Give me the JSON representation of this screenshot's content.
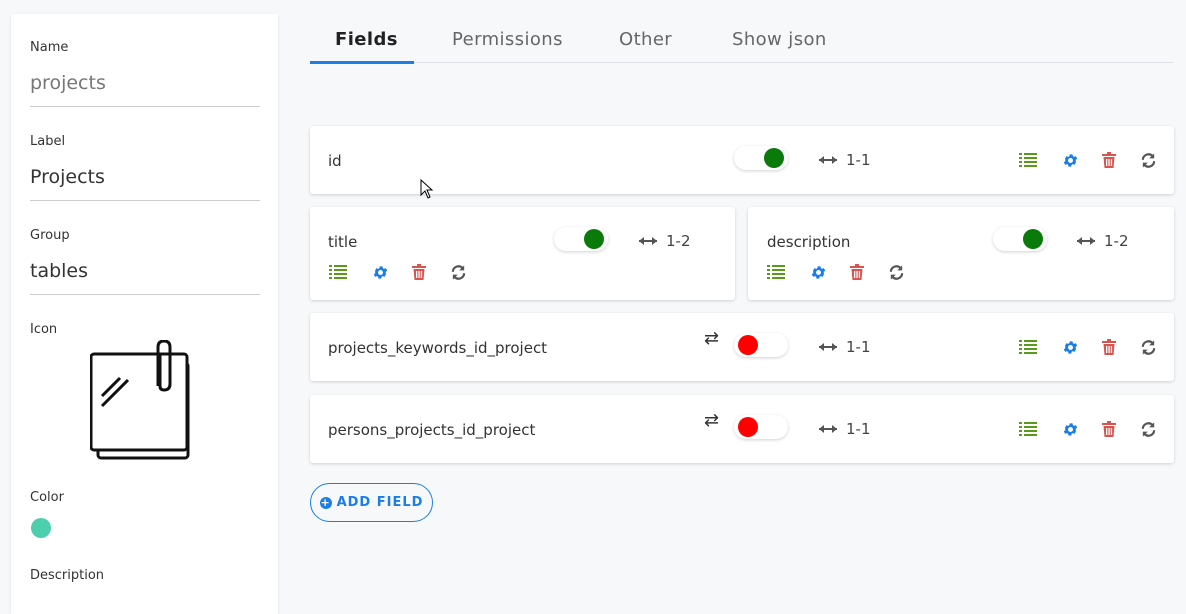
{
  "side": {
    "name_label": "Name",
    "name_value": "projects",
    "label_label": "Label",
    "label_value": "Projects",
    "group_label": "Group",
    "group_value": "tables",
    "icon_label": "Icon",
    "icon_name": "sticky-notes-icon",
    "color_label": "Color",
    "color_value": "#4dcfae",
    "description_label": "Description"
  },
  "tabs": [
    {
      "label": "Fields",
      "active": true
    },
    {
      "label": "Permissions",
      "active": false
    },
    {
      "label": "Other",
      "active": false
    },
    {
      "label": "Show json",
      "active": false
    }
  ],
  "colors": {
    "accent": "#1a7ee6",
    "toggle_on": "#0a7a0a",
    "toggle_off": "#ff0000",
    "list_icon": "#5a9a1a",
    "settings_icon": "#1a7ee6",
    "delete_icon": "#d9534f",
    "refresh_icon": "#555555"
  },
  "fields": [
    {
      "name": "id",
      "enabled": true,
      "relation": "1-1",
      "swap": false
    },
    {
      "name": "title",
      "enabled": true,
      "relation": "1-2",
      "swap": false
    },
    {
      "name": "description",
      "enabled": true,
      "relation": "1-2",
      "swap": false
    },
    {
      "name": "projects_keywords_id_project",
      "enabled": false,
      "relation": "1-1",
      "swap": true
    },
    {
      "name": "persons_projects_id_project",
      "enabled": false,
      "relation": "1-1",
      "swap": true
    }
  ],
  "icons": {
    "relation": "double-arrow-icon",
    "swap": "swap-arrows-icon",
    "list": "list-icon",
    "settings": "gear-icon",
    "delete": "trash-icon",
    "refresh": "refresh-icon"
  },
  "add_button": {
    "label": "ADD FIELD"
  }
}
